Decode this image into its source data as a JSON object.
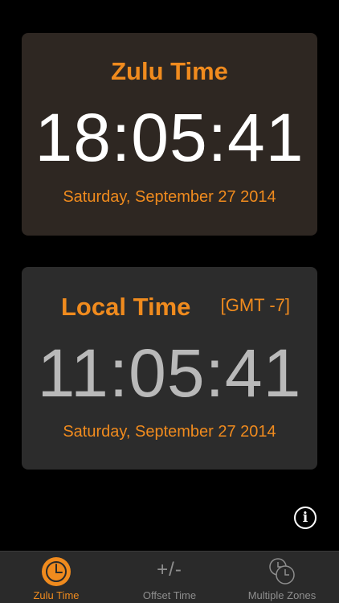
{
  "zulu": {
    "title": "Zulu Time",
    "time": "18:05:41",
    "date": "Saturday, September 27 2014"
  },
  "local": {
    "title": "Local Time",
    "timezone": "[GMT -7]",
    "time": "11:05:41",
    "date": "Saturday, September 27 2014"
  },
  "info": {
    "glyph": "i"
  },
  "tabs": [
    {
      "label": "Zulu Time",
      "icon": "clock-icon",
      "active": true
    },
    {
      "label": "Offset Time",
      "icon": "plus-minus-icon",
      "glyph": "+/-",
      "active": false
    },
    {
      "label": "Multiple Zones",
      "icon": "multiple-clocks-icon",
      "active": false
    }
  ],
  "colors": {
    "accent": "#f08b1e",
    "zulu_card": "#2e2722",
    "local_card": "#2c2c2c",
    "tabbar": "#2a2a2a",
    "inactive": "#8e8e8e"
  }
}
